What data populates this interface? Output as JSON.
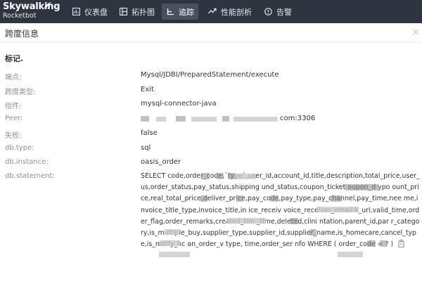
{
  "brand": {
    "name": "Skywalking",
    "product": "Rocketbot"
  },
  "nav": [
    {
      "label": "仪表盘",
      "icon": "dashboard-icon"
    },
    {
      "label": "拓扑图",
      "icon": "topology-icon"
    },
    {
      "label": "追踪",
      "icon": "trace-icon",
      "active": true
    },
    {
      "label": "性能剖析",
      "icon": "profile-icon"
    },
    {
      "label": "告警",
      "icon": "alarm-icon"
    }
  ],
  "panel": {
    "title": "跨度信息",
    "close_icon": "close-icon",
    "section_title": "标记."
  },
  "fields": [
    {
      "key": "端点:",
      "value": "Mysql/JDBI/PreparedStatement/execute"
    },
    {
      "key": "跨度类型:",
      "value": "Exit"
    },
    {
      "key": "组件:",
      "value": "mysql-connector-java"
    },
    {
      "key": "Peer:",
      "value": "com:3306"
    },
    {
      "key": "失败:",
      "value": "false"
    },
    {
      "key": "db.type:",
      "value": "sql"
    },
    {
      "key": "db.instance:",
      "value": "oasis_order"
    },
    {
      "key": "db.statement:",
      "value": "SELECT          code,order_code,`type`,user_id,account_id,title,description,total_price,user_       us,order_status,pay_status,shipping         und_status,coupon_ticket       oupon_d      ypo      ount_price,real_total_price,deliver_price,pay_code,pay_type,pay_channel,pay_time,nee              me,invoice_title_type,invoice_title,in            ice_receiv      voice_receiver_email    k_url,valid_time,order_flag,order_remarks,created_tim       _time,deleted,clini      ntation,parent_id,par             r_category,is_multiple_buy,supplier_type,supplier_id,supplier_name,is_homecare,cancel_type,is_notify_hc       an_order_v        type,       time,order_ser            nfo WHERE ( order_code = ? )"
    }
  ],
  "copy_icon": "copy-icon",
  "colors": {
    "topbar": "#2f3540",
    "active_nav": "#48505e",
    "label": "#8a8f99"
  }
}
